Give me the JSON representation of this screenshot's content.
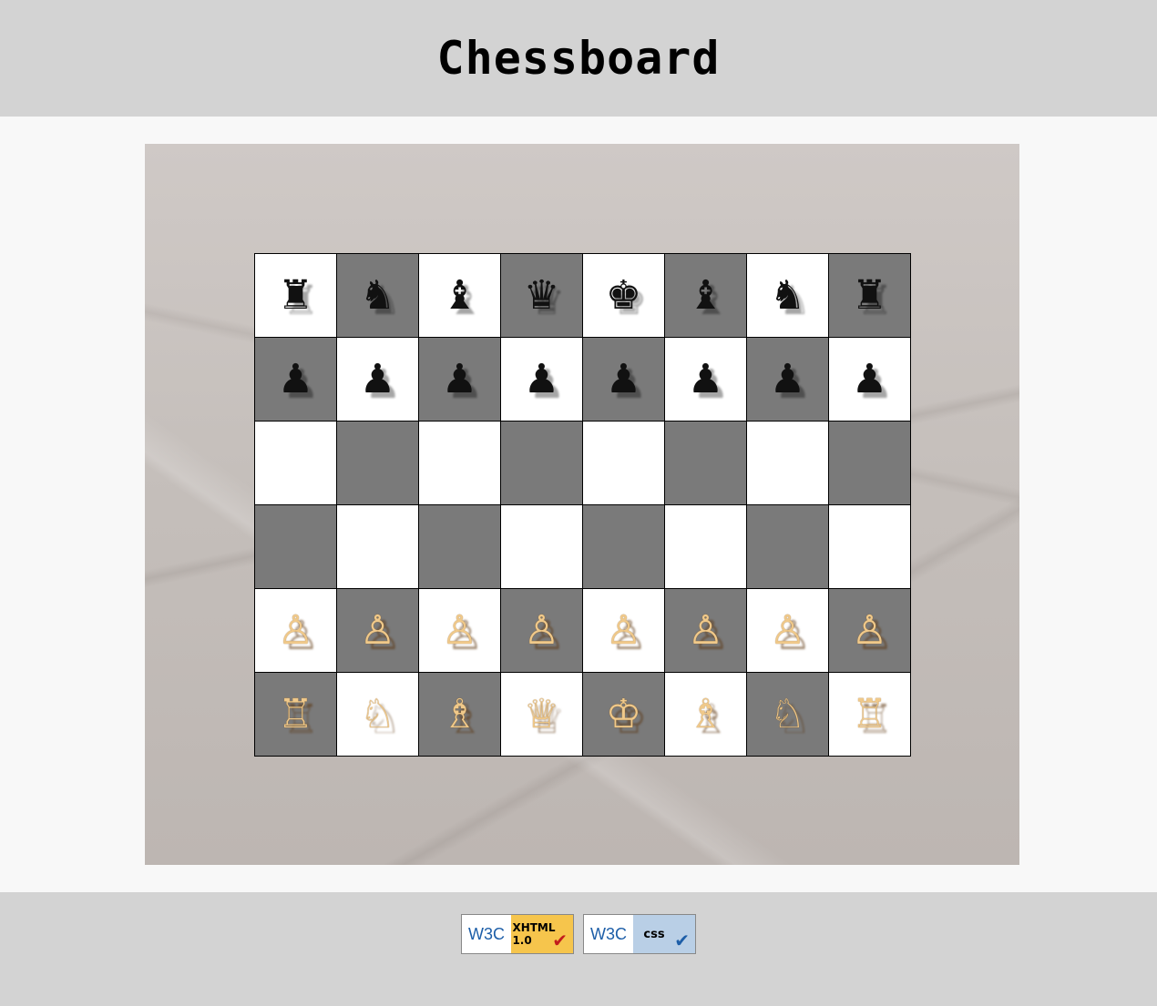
{
  "header": {
    "title": "Chessboard"
  },
  "board": {
    "rows": [
      [
        {
          "glyph": "♜",
          "color": "black"
        },
        {
          "glyph": "♞",
          "color": "black"
        },
        {
          "glyph": "♝",
          "color": "black"
        },
        {
          "glyph": "♛",
          "color": "black"
        },
        {
          "glyph": "♚",
          "color": "black"
        },
        {
          "glyph": "♝",
          "color": "black"
        },
        {
          "glyph": "♞",
          "color": "black"
        },
        {
          "glyph": "♜",
          "color": "black"
        }
      ],
      [
        {
          "glyph": "♟",
          "color": "black"
        },
        {
          "glyph": "♟",
          "color": "black"
        },
        {
          "glyph": "♟",
          "color": "black"
        },
        {
          "glyph": "♟",
          "color": "black"
        },
        {
          "glyph": "♟",
          "color": "black"
        },
        {
          "glyph": "♟",
          "color": "black"
        },
        {
          "glyph": "♟",
          "color": "black"
        },
        {
          "glyph": "♟",
          "color": "black"
        }
      ],
      [
        null,
        null,
        null,
        null,
        null,
        null,
        null,
        null
      ],
      [
        null,
        null,
        null,
        null,
        null,
        null,
        null,
        null
      ],
      [
        {
          "glyph": "♙",
          "color": "white"
        },
        {
          "glyph": "♙",
          "color": "white"
        },
        {
          "glyph": "♙",
          "color": "white"
        },
        {
          "glyph": "♙",
          "color": "white"
        },
        {
          "glyph": "♙",
          "color": "white"
        },
        {
          "glyph": "♙",
          "color": "white"
        },
        {
          "glyph": "♙",
          "color": "white"
        },
        {
          "glyph": "♙",
          "color": "white"
        }
      ],
      [
        {
          "glyph": "♖",
          "color": "white"
        },
        {
          "glyph": "♘",
          "color": "white"
        },
        {
          "glyph": "♗",
          "color": "white"
        },
        {
          "glyph": "♕",
          "color": "white"
        },
        {
          "glyph": "♔",
          "color": "white"
        },
        {
          "glyph": "♗",
          "color": "white"
        },
        {
          "glyph": "♘",
          "color": "white"
        },
        {
          "glyph": "♖",
          "color": "white"
        }
      ]
    ],
    "light_color": "#ffffff",
    "dark_color": "#7a7a7a"
  },
  "footer": {
    "badges": [
      {
        "logo": "W3C",
        "label_line1": "XHTML",
        "label_line2": "1.0",
        "check_color": "#c21c1c"
      },
      {
        "logo": "W3C",
        "label": "css",
        "check_color": "#1d5ea8"
      }
    ]
  }
}
